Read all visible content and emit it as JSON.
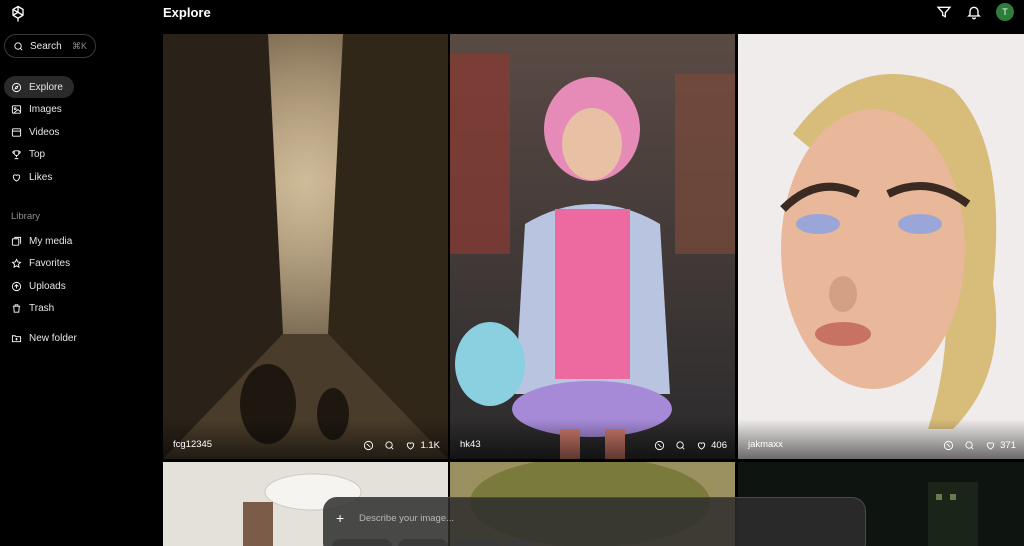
{
  "sidebar": {
    "search_label": "Search",
    "search_shortcut": "⌘K",
    "nav": [
      {
        "label": "Explore",
        "icon": "explore-icon",
        "active": true
      },
      {
        "label": "Images",
        "icon": "image-icon"
      },
      {
        "label": "Videos",
        "icon": "video-icon"
      },
      {
        "label": "Top",
        "icon": "trophy-icon"
      },
      {
        "label": "Likes",
        "icon": "heart-icon"
      }
    ],
    "library_label": "Library",
    "library": [
      {
        "label": "My media",
        "icon": "media-icon"
      },
      {
        "label": "Favorites",
        "icon": "star-icon"
      },
      {
        "label": "Uploads",
        "icon": "upload-icon"
      },
      {
        "label": "Trash",
        "icon": "trash-icon"
      }
    ],
    "new_folder_label": "New folder"
  },
  "header": {
    "title": "Explore",
    "avatar_initial": "T"
  },
  "cards": [
    {
      "author": "fcg12345",
      "likes": "1.1K"
    },
    {
      "author": "hk43",
      "likes": "406"
    },
    {
      "author": "jakmaxx",
      "likes": "371"
    }
  ],
  "prompt": {
    "placeholder": "Describe your image..."
  },
  "colors": {
    "avatar": "#2f7d3a",
    "background": "#000000"
  }
}
